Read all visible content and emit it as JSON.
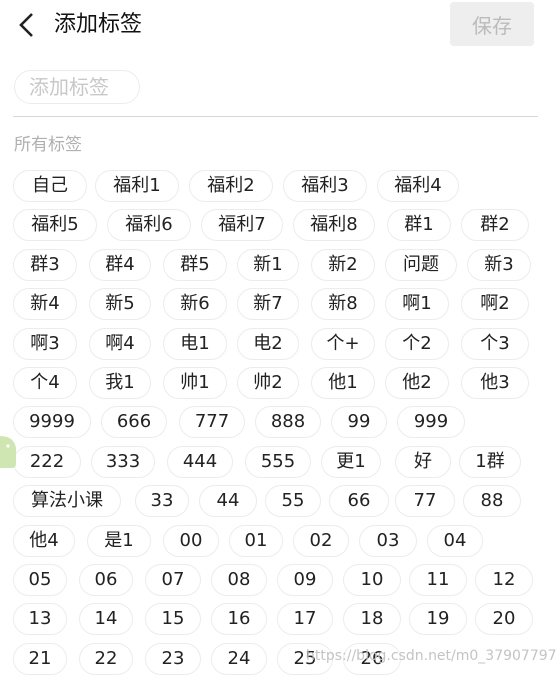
{
  "header": {
    "title": "添加标签",
    "save_label": "保存"
  },
  "input": {
    "placeholder": "添加标签"
  },
  "section_title": "所有标签",
  "tags": [
    "自己",
    "福利1",
    "福利2",
    "福利3",
    "福利4",
    "福利5",
    "福利6",
    "福利7",
    "福利8",
    "群1",
    "群2",
    "群3",
    "群4",
    "群5",
    "新1",
    "新2",
    "问题",
    "新3",
    "新4",
    "新5",
    "新6",
    "新7",
    "新8",
    "啊1",
    "啊2",
    "啊3",
    "啊4",
    "电1",
    "电2",
    "个+",
    "个2",
    "个3",
    "个4",
    "我1",
    "帅1",
    "帅2",
    "他1",
    "他2",
    "他3",
    "9999",
    "666",
    "777",
    "888",
    "99",
    "999",
    "222",
    "333",
    "444",
    "555",
    "更1",
    "好",
    "1群",
    "算法小课",
    "33",
    "44",
    "55",
    "66",
    "77",
    "88",
    "他4",
    "是1",
    "00",
    "01",
    "02",
    "03",
    "04",
    "05",
    "06",
    "07",
    "08",
    "09",
    "10",
    "11",
    "12",
    "13",
    "14",
    "15",
    "16",
    "17",
    "18",
    "19",
    "20",
    "21",
    "22",
    "23",
    "24",
    "25",
    "26"
  ],
  "watermark": "https://blog.csdn.net/m0_37907797"
}
